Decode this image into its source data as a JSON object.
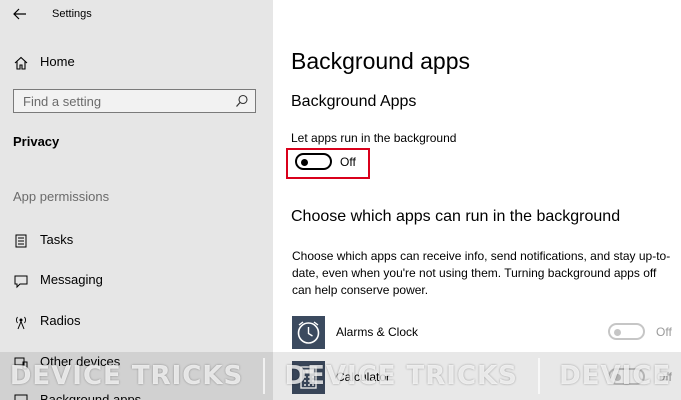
{
  "window": {
    "title": "Settings"
  },
  "sidebar": {
    "home_label": "Home",
    "search_placeholder": "Find a setting",
    "category_label": "Privacy",
    "section_label": "App permissions",
    "items": [
      {
        "label": "Tasks",
        "icon": "tasks-icon"
      },
      {
        "label": "Messaging",
        "icon": "messaging-icon"
      },
      {
        "label": "Radios",
        "icon": "radios-icon"
      },
      {
        "label": "Other devices",
        "icon": "other-devices-icon"
      },
      {
        "label": "Background apps",
        "icon": "background-apps-icon"
      }
    ]
  },
  "main": {
    "title": "Background apps",
    "subtitle": "Background Apps",
    "toggle_caption": "Let apps run in the background",
    "toggle_state": "Off",
    "toggle_on": false,
    "heading": "Choose which apps can run in the background",
    "description": "Choose which apps can receive info, send notifications, and stay up-to-date, even when you're not using them. Turning background apps off can help conserve power.",
    "apps": [
      {
        "name": "Alarms & Clock",
        "state": "Off",
        "icon": "alarm-clock-icon"
      },
      {
        "name": "Calculator",
        "state": "Off",
        "icon": "calculator-icon"
      }
    ]
  },
  "watermark": {
    "text_1": "DEVICE TRICKS",
    "text_2": "DEVICE TRICKS",
    "text_3": "DEVICE"
  },
  "colors": {
    "sidebar_bg": "#e6e6e6",
    "highlight": "#d9001b",
    "app_icon_bg": "#3b4a5f"
  }
}
